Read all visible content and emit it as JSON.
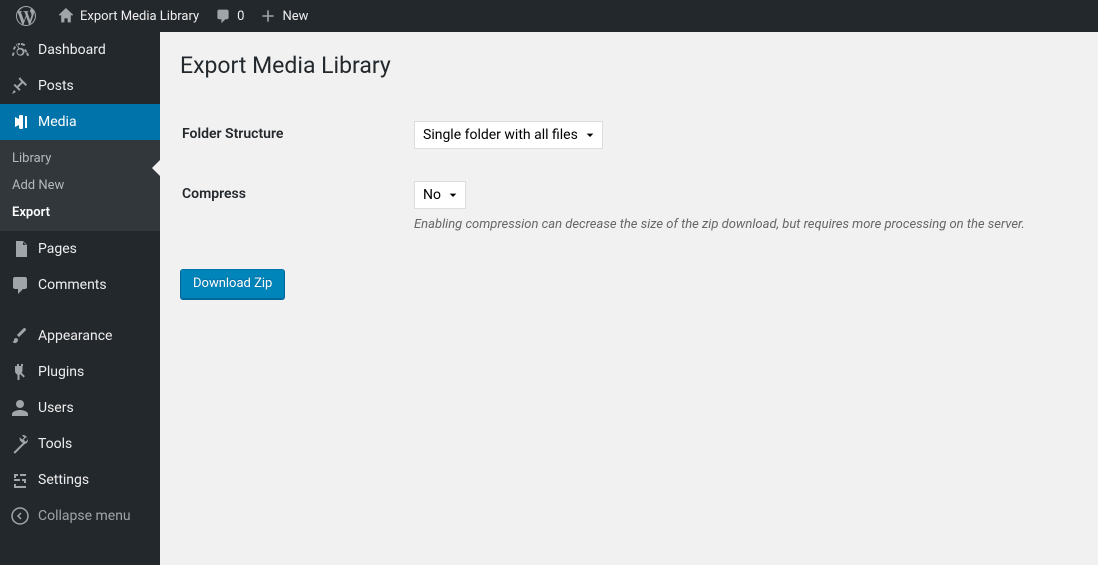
{
  "adminbar": {
    "site_title": "Export Media Library",
    "comments_count": "0",
    "new_label": "New"
  },
  "menu": {
    "dashboard": "Dashboard",
    "posts": "Posts",
    "media": "Media",
    "media_sub": {
      "library": "Library",
      "add_new": "Add New",
      "export": "Export"
    },
    "pages": "Pages",
    "comments": "Comments",
    "appearance": "Appearance",
    "plugins": "Plugins",
    "users": "Users",
    "tools": "Tools",
    "settings": "Settings",
    "collapse": "Collapse menu"
  },
  "page": {
    "title": "Export Media Library",
    "folder_structure_label": "Folder Structure",
    "folder_structure_value": "Single folder with all files",
    "compress_label": "Compress",
    "compress_value": "No",
    "compress_description": "Enabling compression can decrease the size of the zip download, but requires more processing on the server.",
    "submit_label": "Download Zip"
  }
}
